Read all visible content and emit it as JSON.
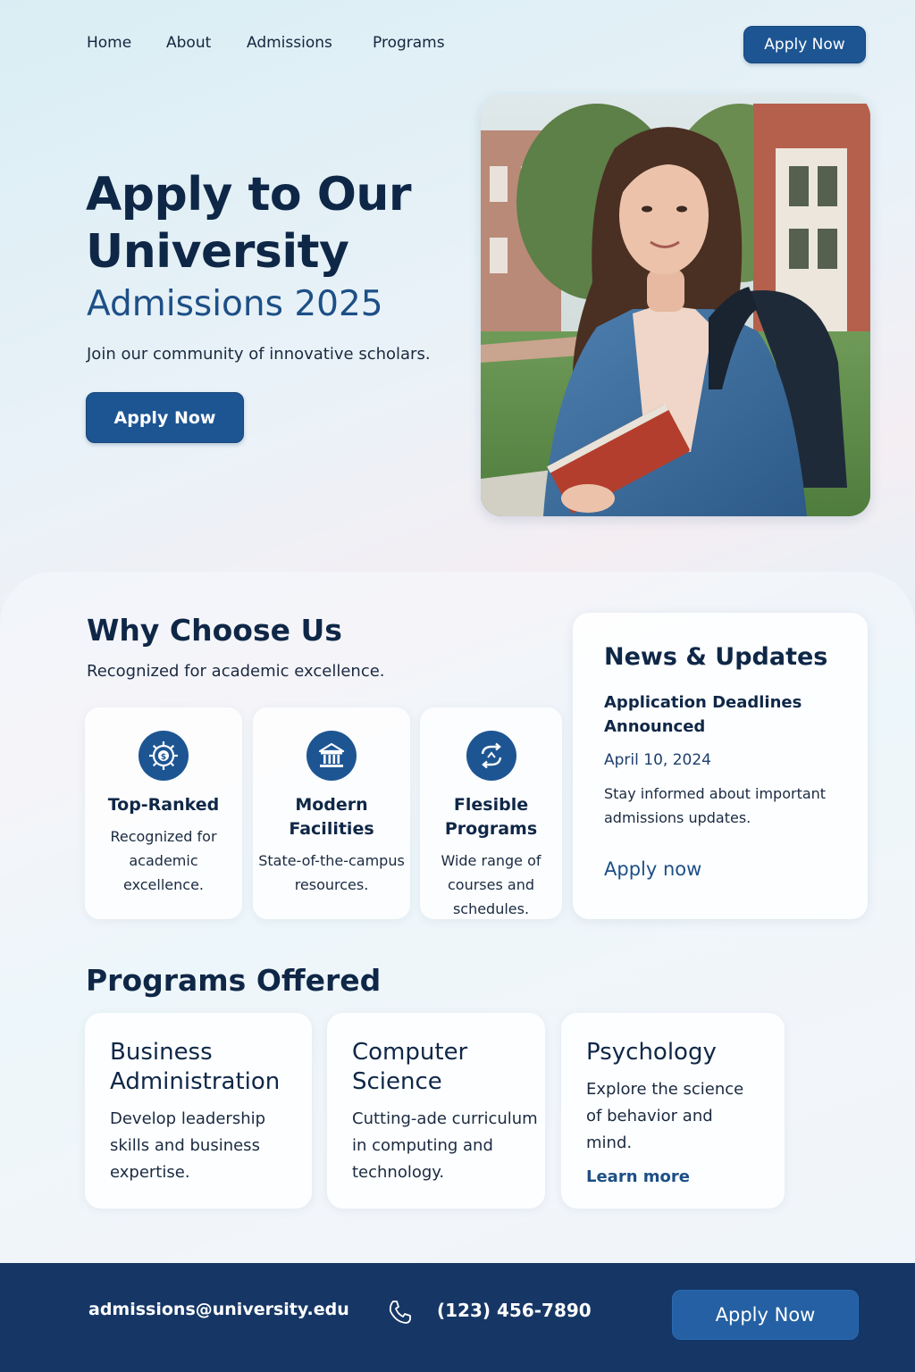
{
  "nav": {
    "links": [
      "Home",
      "About",
      "Admissions",
      "Programs"
    ],
    "cta_label": "Apply Now"
  },
  "hero": {
    "title": "Apply to Our University",
    "subtitle": "Admissions 2025",
    "description": "Join our community of innovative scholars.",
    "cta_label": "Apply Now",
    "photo": "student-with-backpack-and-book-on-campus"
  },
  "why": {
    "title": "Why Choose Us",
    "subtitle": "Recognized for academic excellence.",
    "features": [
      {
        "icon": "award-badge-icon",
        "title": "Top-Ranked",
        "desc": "Recognized for academic excellence."
      },
      {
        "icon": "building-columns-icon",
        "title": "Modern Facilities",
        "desc": "State-of-the-campus resources."
      },
      {
        "icon": "arrows-cycle-icon",
        "title": "Flesible Programs",
        "desc": "Wide range of courses and schedules."
      }
    ]
  },
  "news": {
    "title": "News & Updates",
    "headline": "Application Deadlines Announced",
    "date": "April 10, 2024",
    "description": "Stay informed about important admissions updates.",
    "link_label": "Apply now"
  },
  "programs": {
    "title": "Programs Offered",
    "items": [
      {
        "title": "Business Administration",
        "desc": "Develop leadership skills and business expertise.",
        "link": ""
      },
      {
        "title": "Computer Science",
        "desc": "Cutting-ade curriculum in computing and technology.",
        "link": ""
      },
      {
        "title": "Psychology",
        "desc": "Explore the science of behavior and mind.",
        "link": "Learn more"
      }
    ]
  },
  "footer": {
    "email": "admissions@university.edu",
    "phone_icon": "phone-icon",
    "phone": "(123) 456-7890",
    "cta_label": "Apply Now"
  },
  "colors": {
    "primary": "#1d5593",
    "footer_bg": "#163766",
    "heading": "#0f2747"
  }
}
